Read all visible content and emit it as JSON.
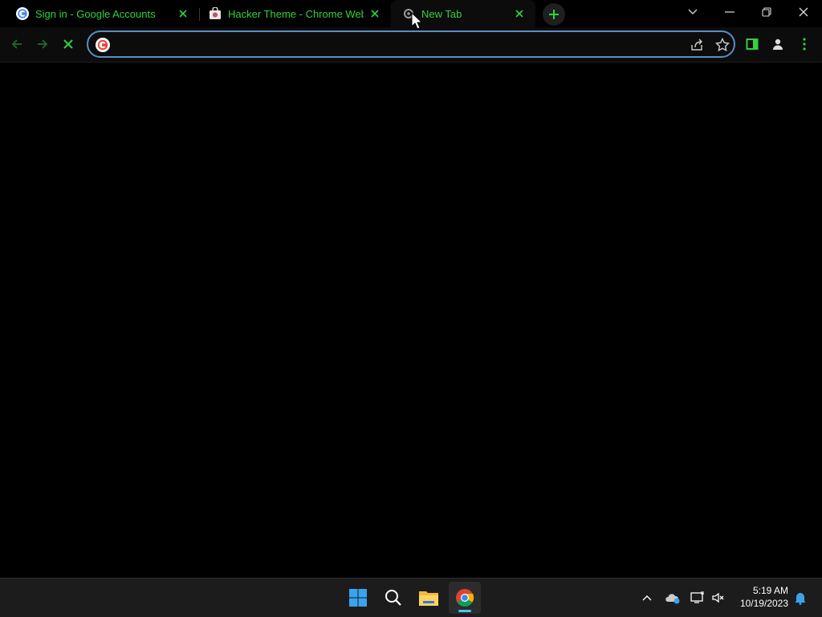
{
  "tabs": [
    {
      "title": "Sign in - Google Accounts",
      "favicon": "google-g-icon",
      "active": false
    },
    {
      "title": "Hacker Theme - Chrome Web Store",
      "favicon": "chrome-web-store-icon",
      "active": false
    },
    {
      "title": "New Tab",
      "favicon": "loading-globe-icon",
      "active": true
    }
  ],
  "omnibox": {
    "value": "",
    "placeholder": ""
  },
  "theme": {
    "accent": "#31d13f",
    "background": "#000000",
    "omnibox_border": "#5a8ec8"
  },
  "taskbar": {
    "apps": [
      "windows-start-icon",
      "search-icon",
      "file-explorer-icon",
      "chrome-icon"
    ],
    "clock": {
      "time": "5:19 AM",
      "date": "10/19/2023"
    }
  }
}
